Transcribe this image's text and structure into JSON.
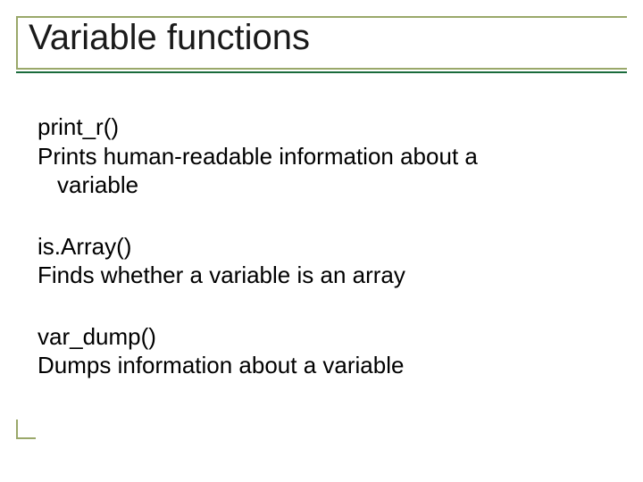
{
  "title": "Variable functions",
  "functions": [
    {
      "name": "print_r()",
      "desc_line1": "Prints human-readable information about a",
      "desc_line2": "variable"
    },
    {
      "name": "is.Array()",
      "desc_line1": "Finds whether a variable is an array",
      "desc_line2": ""
    },
    {
      "name": "var_dump()",
      "desc_line1": "Dumps information about a variable",
      "desc_line2": ""
    }
  ]
}
